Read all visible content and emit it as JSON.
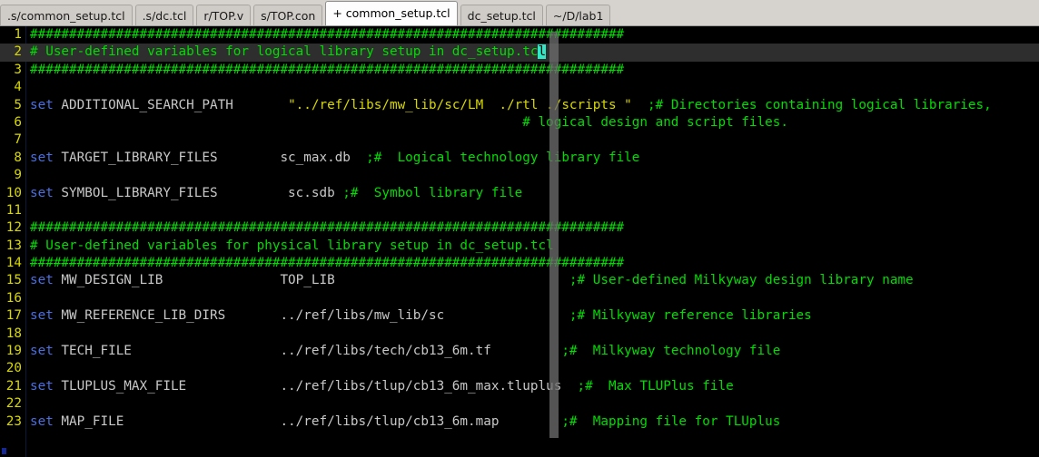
{
  "window": {
    "type": "text-editor",
    "theme_background": "#000000",
    "linenumber_color": "#d8d800",
    "comment_color": "#00dd00",
    "keyword_color": "#4a6fe0",
    "variable_color": "#30b8a8",
    "string_color": "#d8d800",
    "current_line_highlight": "#2e2e2e",
    "cursor_color": "#2ee8c8"
  },
  "tabs": [
    {
      "label": ".s/common_setup.tcl",
      "active": false
    },
    {
      "label": ".s/dc.tcl",
      "active": false
    },
    {
      "label": "r/TOP.v",
      "active": false
    },
    {
      "label": "s/TOP.con",
      "active": false
    },
    {
      "label": "+ common_setup.tcl",
      "active": true
    },
    {
      "label": "dc_setup.tcl",
      "active": false
    },
    {
      "label": "~/D/lab1",
      "active": false
    }
  ],
  "editor": {
    "active_file": "common_setup.tcl",
    "modified_marker": "+",
    "cursor_line": 2,
    "cursor_char": "l",
    "lines": [
      {
        "number": "1",
        "current": false,
        "spans": [
          {
            "cls": "c-comment",
            "text": "############################################################################"
          }
        ]
      },
      {
        "number": "2",
        "current": true,
        "spans": [
          {
            "cls": "c-comment",
            "text": "# User-defined variables for logical library setup in dc_setup.tc"
          },
          {
            "cls": "cursor",
            "text": "l"
          }
        ]
      },
      {
        "number": "3",
        "current": false,
        "spans": [
          {
            "cls": "c-comment",
            "text": "############################################################################"
          }
        ]
      },
      {
        "number": "4",
        "current": false,
        "spans": []
      },
      {
        "number": "5",
        "current": false,
        "spans": [
          {
            "cls": "c-kw",
            "text": "set"
          },
          {
            "cls": "c-plain",
            "text": " ADDITIONAL_SEARCH_PATH       "
          },
          {
            "cls": "c-str",
            "text": "\"../ref/libs/mw_lib/sc/LM  ./rtl ./scripts \""
          },
          {
            "cls": "c-comment",
            "text": "  ;# Directories containing logical libraries,"
          }
        ]
      },
      {
        "number": "6",
        "current": false,
        "spans": [
          {
            "cls": "c-comment",
            "text": "                                                               # logical design and script files."
          }
        ]
      },
      {
        "number": "7",
        "current": false,
        "spans": []
      },
      {
        "number": "8",
        "current": false,
        "spans": [
          {
            "cls": "c-kw",
            "text": "set"
          },
          {
            "cls": "c-plain",
            "text": " TARGET_LIBRARY_FILES        sc_max.db"
          },
          {
            "cls": "c-comment",
            "text": "  ;#  Logical technology library file"
          }
        ]
      },
      {
        "number": "9",
        "current": false,
        "spans": []
      },
      {
        "number": "10",
        "current": false,
        "spans": [
          {
            "cls": "c-kw",
            "text": "set"
          },
          {
            "cls": "c-plain",
            "text": " SYMBOL_LIBRARY_FILES         sc.sdb"
          },
          {
            "cls": "c-comment",
            "text": " ;#  Symbol library file"
          }
        ]
      },
      {
        "number": "11",
        "current": false,
        "spans": []
      },
      {
        "number": "12",
        "current": false,
        "spans": [
          {
            "cls": "c-comment",
            "text": "############################################################################"
          }
        ]
      },
      {
        "number": "13",
        "current": false,
        "spans": [
          {
            "cls": "c-comment",
            "text": "# User-defined variables for physical library setup in dc_setup.tcl"
          }
        ]
      },
      {
        "number": "14",
        "current": false,
        "spans": [
          {
            "cls": "c-comment",
            "text": "############################################################################"
          }
        ]
      },
      {
        "number": "15",
        "current": false,
        "spans": [
          {
            "cls": "c-kw",
            "text": "set"
          },
          {
            "cls": "c-plain",
            "text": " MW_DESIGN_LIB               TOP_LIB                           "
          },
          {
            "cls": "c-comment",
            "text": "   ;# User-defined Milkyway design library name"
          }
        ]
      },
      {
        "number": "16",
        "current": false,
        "spans": []
      },
      {
        "number": "17",
        "current": false,
        "spans": [
          {
            "cls": "c-kw",
            "text": "set"
          },
          {
            "cls": "c-plain",
            "text": " MW_REFERENCE_LIB_DIRS       ../ref/libs/mw_lib/sc            "
          },
          {
            "cls": "c-comment",
            "text": "    ;# Milkyway reference libraries"
          }
        ]
      },
      {
        "number": "18",
        "current": false,
        "spans": []
      },
      {
        "number": "19",
        "current": false,
        "spans": [
          {
            "cls": "c-kw",
            "text": "set"
          },
          {
            "cls": "c-plain",
            "text": " TECH_FILE                   ../ref/libs/tech/cb13_6m.tf       "
          },
          {
            "cls": "c-comment",
            "text": "  ;#  Milkyway technology file"
          }
        ]
      },
      {
        "number": "20",
        "current": false,
        "spans": []
      },
      {
        "number": "21",
        "current": false,
        "spans": [
          {
            "cls": "c-kw",
            "text": "set"
          },
          {
            "cls": "c-plain",
            "text": " TLUPLUS_MAX_FILE            ../ref/libs/tlup/cb13_6m_max.tluplus"
          },
          {
            "cls": "c-comment",
            "text": "  ;#  Max TLUPlus file"
          }
        ]
      },
      {
        "number": "22",
        "current": false,
        "spans": []
      },
      {
        "number": "23",
        "current": false,
        "spans": [
          {
            "cls": "c-kw",
            "text": "set"
          },
          {
            "cls": "c-plain",
            "text": " MAP_FILE                    ../ref/libs/tlup/cb13_6m.map      "
          },
          {
            "cls": "c-comment",
            "text": "  ;#  Mapping file for TLUplus"
          }
        ]
      }
    ]
  }
}
